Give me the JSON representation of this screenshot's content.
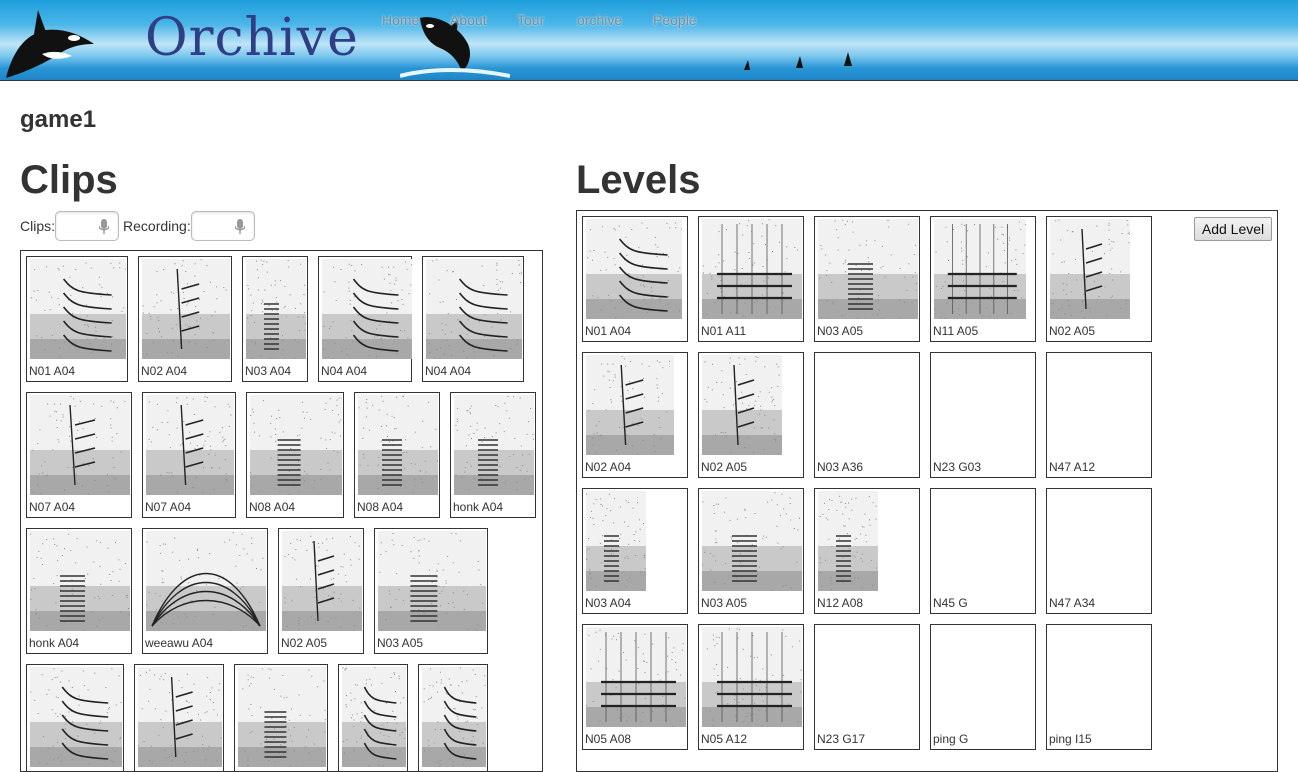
{
  "header": {
    "logo_text": "Orchive",
    "nav": [
      "Home",
      "About",
      "Tour",
      "orchive",
      "People"
    ]
  },
  "page_title": "game1",
  "clips": {
    "title": "Clips",
    "clips_field_label": "Clips:",
    "recording_field_label": "Recording:",
    "items": [
      {
        "label": "N01 A04",
        "pattern": "curves"
      },
      {
        "label": "N02 A04",
        "pattern": "steps"
      },
      {
        "label": "N03 A04",
        "pattern": "pulse"
      },
      {
        "label": "N04 A04",
        "pattern": "curves"
      },
      {
        "label": "N04 A04",
        "pattern": "curves"
      },
      {
        "label": "N07 A04",
        "pattern": "steps"
      },
      {
        "label": "N07 A04",
        "pattern": "steps"
      },
      {
        "label": "N08 A04",
        "pattern": "pulse"
      },
      {
        "label": "N08 A04",
        "pattern": "pulse"
      },
      {
        "label": "honk A04",
        "pattern": "pulse"
      },
      {
        "label": "honk A04",
        "pattern": "pulse"
      },
      {
        "label": "weeawu A04",
        "pattern": "arches"
      },
      {
        "label": "N02 A05",
        "pattern": "steps"
      },
      {
        "label": "N03 A05",
        "pattern": "pulse"
      },
      {
        "label": "",
        "pattern": "curves"
      },
      {
        "label": "",
        "pattern": "steps"
      },
      {
        "label": "",
        "pattern": "pulse"
      },
      {
        "label": "",
        "pattern": "curves"
      },
      {
        "label": "",
        "pattern": "curves"
      }
    ]
  },
  "levels": {
    "title": "Levels",
    "add_button": "Add Level",
    "items": [
      {
        "label": "N01 A04",
        "pattern": "curves"
      },
      {
        "label": "N01 A11",
        "pattern": "bands"
      },
      {
        "label": "N03 A05",
        "pattern": "pulse"
      },
      {
        "label": "N11 A05",
        "pattern": "bands"
      },
      {
        "label": "N02 A05",
        "pattern": "steps"
      },
      {
        "label": "N02 A04",
        "pattern": "steps"
      },
      {
        "label": "N02 A05",
        "pattern": "steps"
      },
      {
        "label": "N03 A36",
        "pattern": "none"
      },
      {
        "label": "N23 G03",
        "pattern": "none"
      },
      {
        "label": "N47 A12",
        "pattern": "none"
      },
      {
        "label": "N03 A04",
        "pattern": "pulse"
      },
      {
        "label": "N03 A05",
        "pattern": "pulse"
      },
      {
        "label": "N12 A08",
        "pattern": "pulse"
      },
      {
        "label": "N45 G",
        "pattern": "none"
      },
      {
        "label": "N47 A34",
        "pattern": "none"
      },
      {
        "label": "N05 A08",
        "pattern": "bands"
      },
      {
        "label": "N05 A12",
        "pattern": "bands"
      },
      {
        "label": "N23 G17",
        "pattern": "none"
      },
      {
        "label": "ping G",
        "pattern": "none"
      },
      {
        "label": "ping I15",
        "pattern": "none"
      }
    ]
  }
}
